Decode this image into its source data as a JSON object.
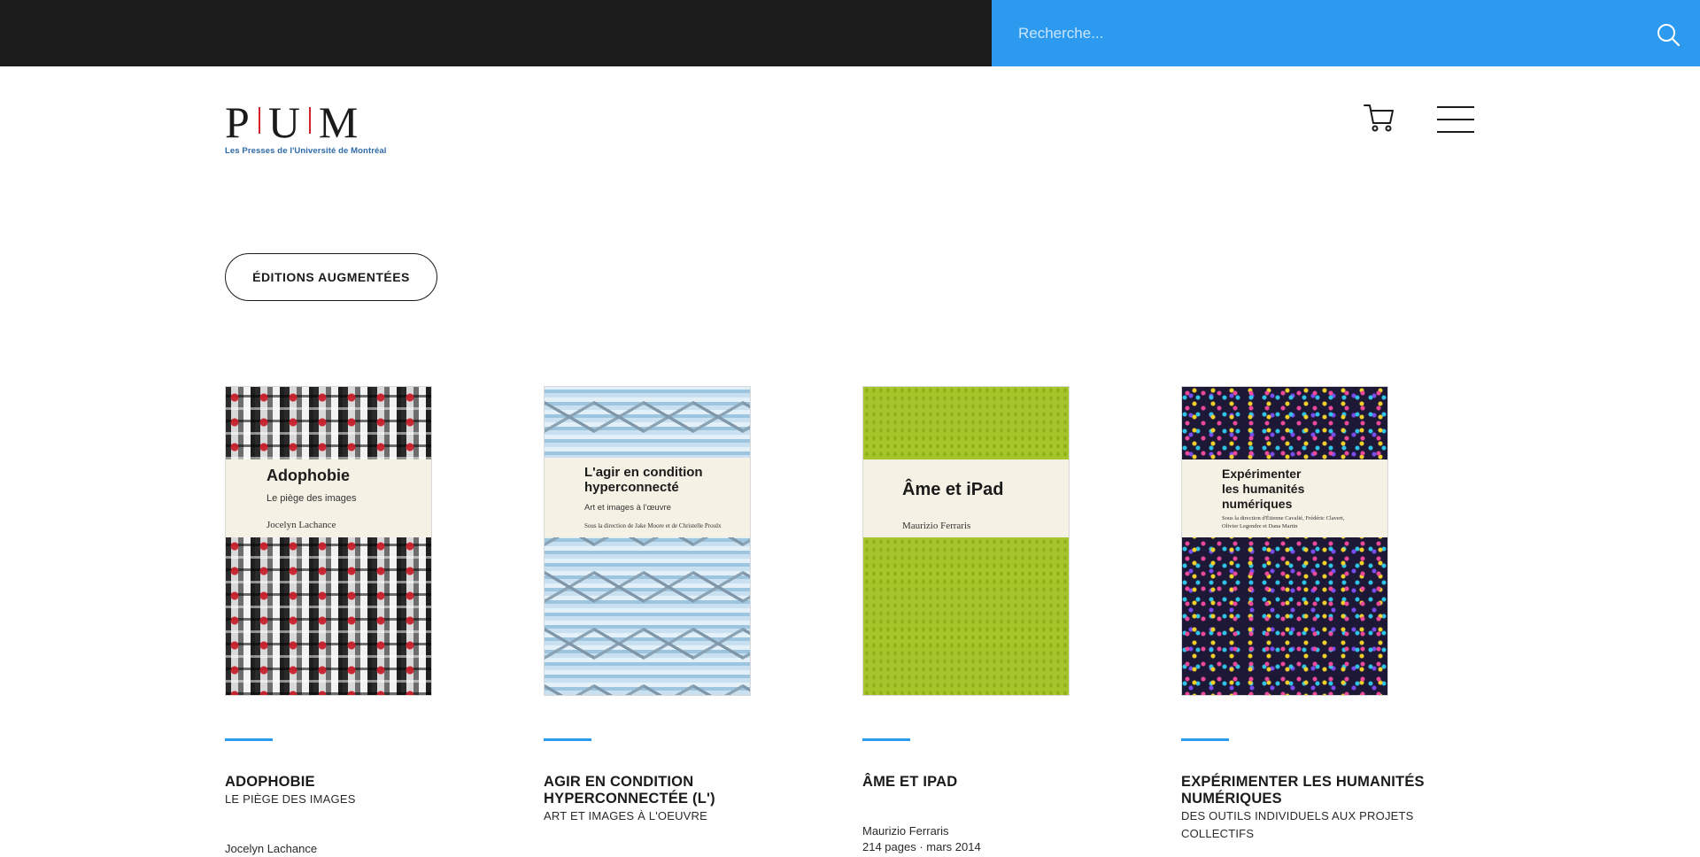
{
  "search": {
    "placeholder": "Recherche..."
  },
  "logo": {
    "letters": [
      "P",
      "U",
      "M"
    ],
    "subtitle": "Les Presses de l'Université de Montréal"
  },
  "colors": {
    "topbar": "#1b1b1b",
    "search_bg": "#2b9aef",
    "accent": "#2b9aef",
    "logo_red": "#d4202a",
    "logo_blue": "#2f6aa8"
  },
  "filter": {
    "label": "ÉDITIONS AUGMENTÉES"
  },
  "books": [
    {
      "cover": {
        "title": "Adophobie",
        "subtitle": "Le piège des images",
        "author": "Jocelyn Lachance"
      },
      "title": "ADOPHOBIE",
      "subtitle": "LE PIÈGE DES IMAGES",
      "author": "Jocelyn Lachance",
      "meta": ""
    },
    {
      "cover": {
        "title_line1": "L'agir en condition",
        "title_line2": "hyperconnecté",
        "subtitle": "Art et images à l'œuvre",
        "editors": "Sous la direction de Jake Moore et de Christelle Proulx"
      },
      "title": "AGIR EN CONDITION HYPERCONNECTÉE (L')",
      "subtitle": "ART ET IMAGES À L'OEUVRE",
      "author": "",
      "meta": ""
    },
    {
      "cover": {
        "title": "Âme et iPad",
        "author": "Maurizio Ferraris"
      },
      "title": "ÂME ET IPAD",
      "subtitle": "",
      "author": "Maurizio Ferraris",
      "meta": "214 pages · mars 2014"
    },
    {
      "cover": {
        "title_line1": "Expérimenter",
        "title_line2": "les humanités",
        "title_line3": "numériques",
        "editors_line1": "Sous la direction d'Étienne Cavalié, Frédéric Clavert,",
        "editors_line2": "Olivier Legendre et Dana Martin"
      },
      "title": "EXPÉRIMENTER LES HUMANITÉS NUMÉRIQUES",
      "subtitle": "DES OUTILS INDIVIDUELS AUX PROJETS COLLECTIFS",
      "author": "",
      "meta": ""
    }
  ]
}
